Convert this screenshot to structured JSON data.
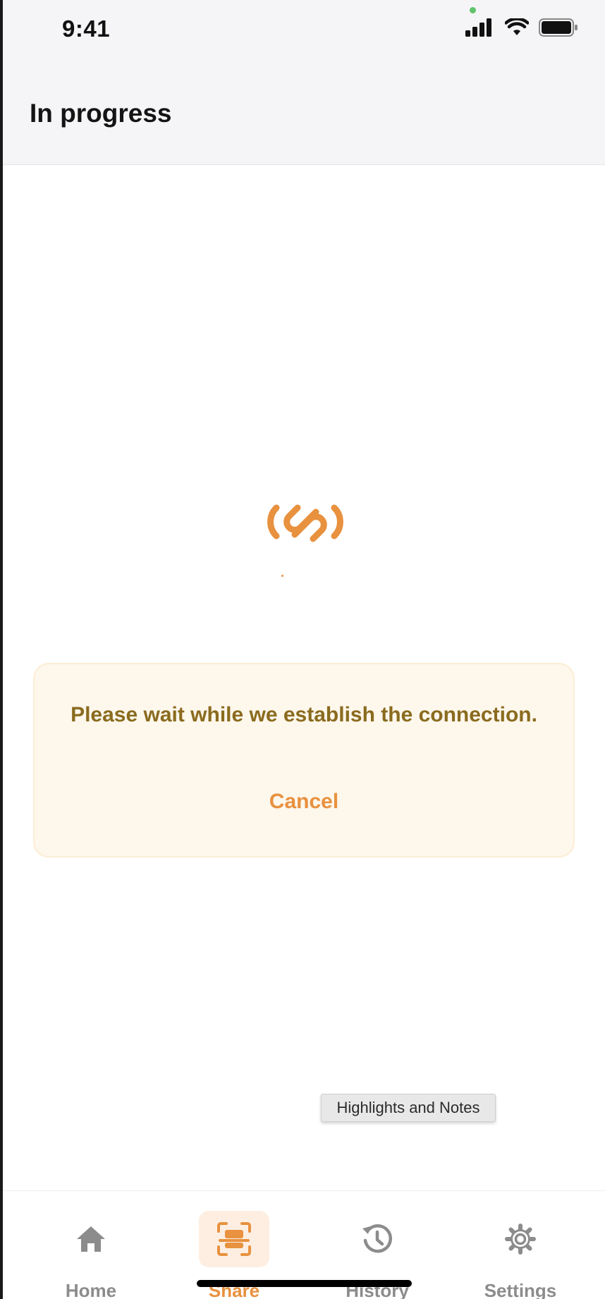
{
  "status_bar": {
    "time": "9:41",
    "icons": [
      "signal-icon",
      "wifi-icon",
      "battery-icon"
    ]
  },
  "header": {
    "title": "In progress"
  },
  "logo": {
    "name": "connection-logo-icon",
    "color": "#e8913f"
  },
  "notice": {
    "message": "Please wait while we establish the connection.",
    "cancel_label": "Cancel",
    "background": "#fdf7ec",
    "text_color": "#8a6b1e",
    "accent": "#e8913f"
  },
  "tooltip": {
    "text": "Highlights and Notes"
  },
  "tabbar": {
    "active": "share",
    "tabs": [
      {
        "id": "home",
        "label": "Home",
        "icon": "home-icon"
      },
      {
        "id": "share",
        "label": "Share",
        "icon": "scan-share-icon"
      },
      {
        "id": "history",
        "label": "History",
        "icon": "history-icon"
      },
      {
        "id": "settings",
        "label": "Settings",
        "icon": "gear-icon"
      }
    ]
  }
}
